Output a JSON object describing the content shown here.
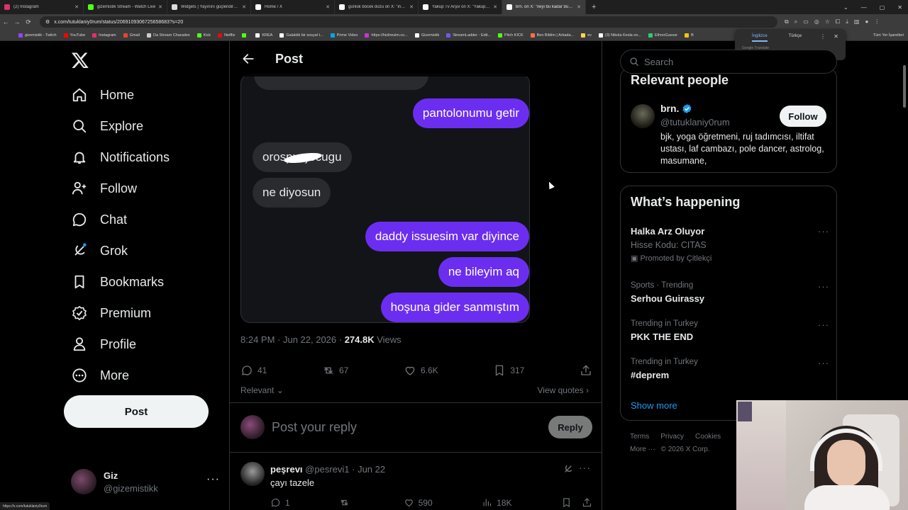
{
  "browser": {
    "tabs": [
      {
        "title": "(2) Instagram",
        "color": "#e1306c"
      },
      {
        "title": "gizemistik Stream - Watch Live",
        "color": "#53fc18"
      },
      {
        "title": "Widgets | Yayınını güçlendirmek",
        "color": "#dddddd"
      },
      {
        "title": "Home / X",
        "color": "#ffffff"
      },
      {
        "title": "günlük böcek dozu on X: \"inşallah",
        "color": "#ffffff"
      },
      {
        "title": "Yakup Tv Arşiv on X: \"Yakup Tv",
        "color": "#ffffff"
      },
      {
        "title": "brn. on X: \"neyi bu kadar büyüt",
        "color": "#ffffff",
        "active": true
      }
    ],
    "url": "x.com/tutuklaniy0rum/status/2069109306725658683?s=20",
    "bookmarks": [
      {
        "label": "gizemistik - Twitch",
        "color": "#9146ff"
      },
      {
        "label": "YouTube",
        "color": "#ff0000"
      },
      {
        "label": "Instagram",
        "color": "#e1306c"
      },
      {
        "label": "Gmail",
        "color": "#ea4335"
      },
      {
        "label": "Da Stream Charades",
        "color": "#cccccc"
      },
      {
        "label": "Kick",
        "color": "#53fc18"
      },
      {
        "label": "Netflix",
        "color": "#e50914"
      },
      {
        "label": "",
        "color": "#53fc18"
      },
      {
        "label": "KREA",
        "color": "#ffffff"
      },
      {
        "label": "Galaktik bir sosyal t...",
        "color": "#ffffff"
      },
      {
        "label": "Prime Video",
        "color": "#00a8e1"
      },
      {
        "label": "https://hizliresim.co...",
        "color": "#cc33cc"
      },
      {
        "label": "Gizemistik",
        "color": "#ffffff"
      },
      {
        "label": "StreamLadder - Edit...",
        "color": "#6c5ce7"
      },
      {
        "label": "Pitch KICK",
        "color": "#53fc18"
      },
      {
        "label": "Ben Bildim | Arkada...",
        "color": "#ff7043"
      },
      {
        "label": "ev",
        "color": "#ffd54f"
      },
      {
        "label": "(3) Nikola Kesla on...",
        "color": "#ffffff"
      },
      {
        "label": "EthnoGuessr",
        "color": "#2ecc71"
      },
      {
        "label": "B",
        "color": "#f1c40f"
      }
    ],
    "bookmarks_all": "Tüm Yer İşaretleri",
    "translate": {
      "lang1": "İngilizce",
      "lang2": "Türkçe",
      "provider": "Google Translate"
    },
    "status_url": "https://x.com/tutuklaniy0rum"
  },
  "nav": {
    "items": [
      {
        "label": "Home",
        "icon": "home-icon"
      },
      {
        "label": "Explore",
        "icon": "search-icon"
      },
      {
        "label": "Notifications",
        "icon": "bell-icon"
      },
      {
        "label": "Follow",
        "icon": "person-plus-icon"
      },
      {
        "label": "Chat",
        "icon": "chat-icon"
      },
      {
        "label": "Grok",
        "icon": "grok-icon"
      },
      {
        "label": "Bookmarks",
        "icon": "bookmark-icon"
      },
      {
        "label": "Premium",
        "icon": "premium-icon"
      },
      {
        "label": "Profile",
        "icon": "profile-icon"
      },
      {
        "label": "More",
        "icon": "more-icon"
      }
    ],
    "post_label": "Post",
    "account": {
      "name": "Giz",
      "handle": "@gizemistikk"
    }
  },
  "post": {
    "header_title": "Post",
    "chat": [
      {
        "text": "pantolonumu getir",
        "side": "right"
      },
      {
        "text": "orospu çocugu",
        "side": "left"
      },
      {
        "text": "ne diyosun",
        "side": "left"
      },
      {
        "text": "daddy issuesim var diyince",
        "side": "right"
      },
      {
        "text": "ne bileyim aq",
        "side": "right"
      },
      {
        "text": "hoşuna gider sanmıştım",
        "side": "right"
      }
    ],
    "time": "8:24 PM · Jun 22, 2026 · ",
    "views_count": "274.8K",
    "views_label": " Views",
    "replies": "41",
    "reposts": "67",
    "likes": "6.6K",
    "bookmarks": "317",
    "sort_label": "Relevant",
    "quotes_label": "View quotes",
    "reply_placeholder": "Post your reply",
    "reply_button": "Reply",
    "bubble_color": "#6b2ef0"
  },
  "comment": {
    "name": "peşrevı",
    "handle": "@pesrevi1",
    "date": "· Jun 22",
    "text": "çayı tazele",
    "replies": "1",
    "reposts": "",
    "likes": "590",
    "views": "18K"
  },
  "sidebar": {
    "search_placeholder": "Search",
    "relevant_title": "Relevant people",
    "person": {
      "name": "brn.",
      "handle": "@tutuklaniy0rum",
      "bio": "bjk, yoga öğretmeni, ruj tadımcısı, iltifat ustası, laf cambazı, pole dancer, astrolog, masumane,",
      "follow_label": "Follow"
    },
    "happening_title": "What’s happening",
    "trends": [
      {
        "context": "",
        "title": "Halka Arz Oluyor",
        "sub": "Hisse Kodu: CITAS",
        "promo": "Promoted by Çitlekçi"
      },
      {
        "context": "Sports · Trending",
        "title": "Serhou Guirassy"
      },
      {
        "context": "Trending in Turkey",
        "title": "PKK THE END"
      },
      {
        "context": "Trending in Turkey",
        "title": "#deprem"
      }
    ],
    "show_more": "Show more",
    "footer": {
      "terms": "Terms",
      "privacy": "Privacy",
      "cookies": "Cookies",
      "more": "More ···",
      "copyright": "© 2026 X Corp."
    },
    "accent": "#1d9bf0"
  }
}
